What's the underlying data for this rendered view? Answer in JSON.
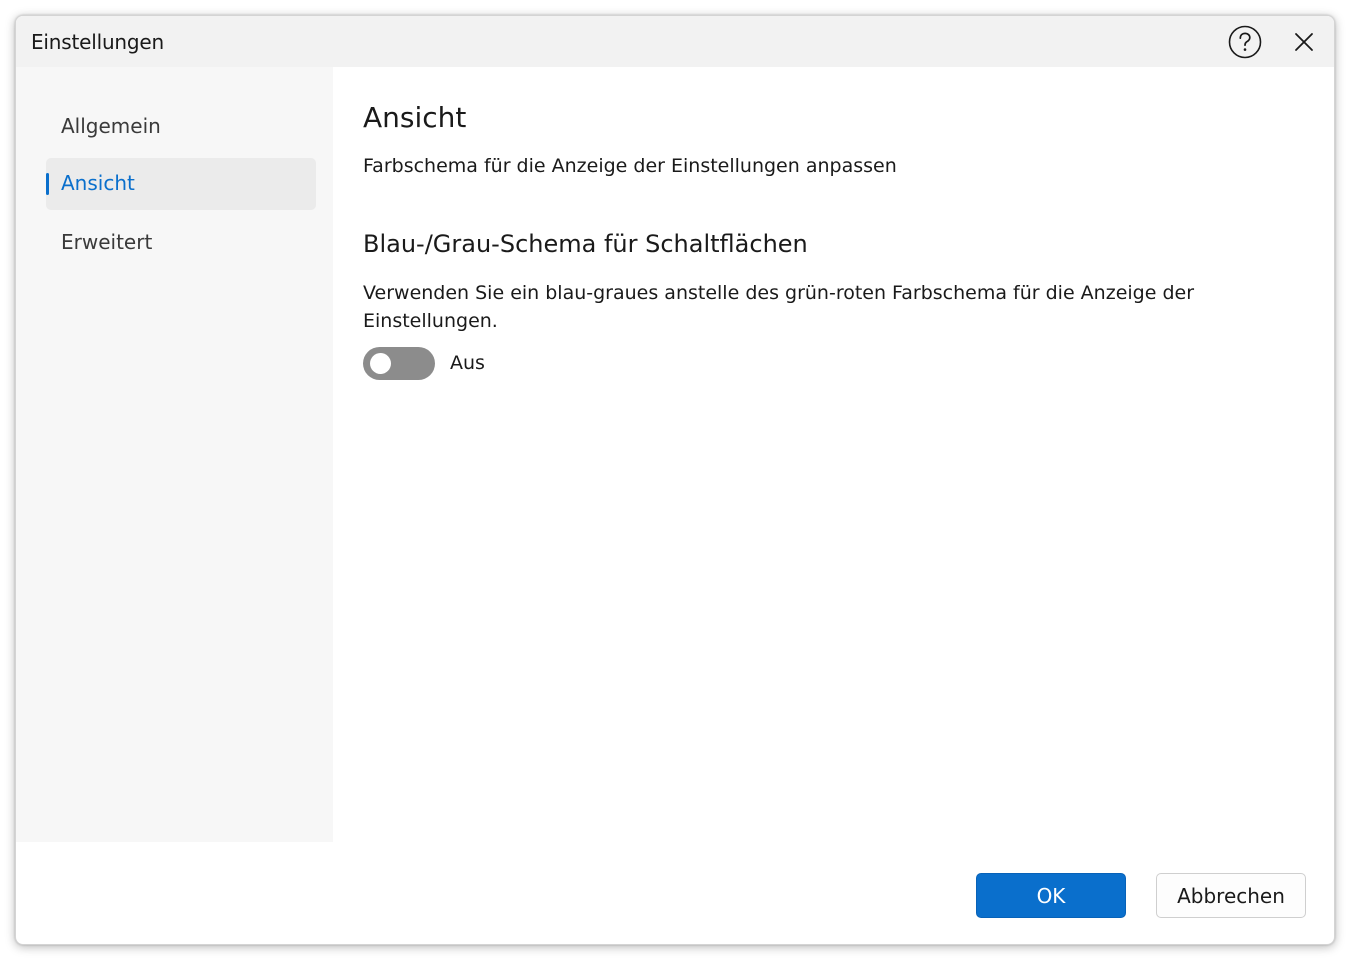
{
  "window": {
    "title": "Einstellungen",
    "help_icon": "question-circle-icon",
    "close_icon": "close-icon"
  },
  "sidebar": {
    "items": [
      {
        "label": "Allgemein",
        "active": false
      },
      {
        "label": "Ansicht",
        "active": true
      },
      {
        "label": "Erweitert",
        "active": false
      }
    ]
  },
  "main": {
    "title": "Ansicht",
    "subtitle": "Farbschema für die Anzeige der Einstellungen anpassen",
    "section": {
      "title": "Blau-/Grau-Schema für Schaltflächen",
      "description": "Verwenden Sie ein blau-graues anstelle des grün-roten Farbschema für die Anzeige der Einstellungen.",
      "toggle": {
        "state": false,
        "label": "Aus"
      }
    }
  },
  "footer": {
    "ok_label": "OK",
    "cancel_label": "Abbrechen"
  },
  "colors": {
    "accent": "#0a6fcc",
    "sidebar_bg": "#f7f7f7",
    "titlebar_bg": "#f2f2f2",
    "toggle_off": "#8c8c8c"
  }
}
